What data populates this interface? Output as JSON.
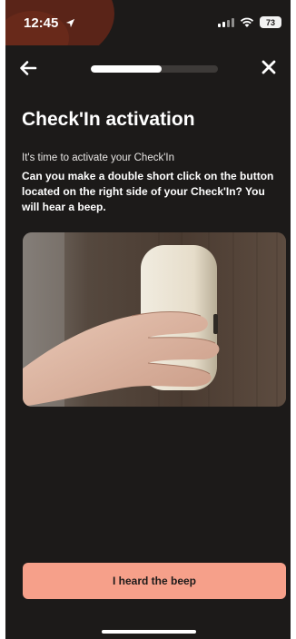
{
  "status_bar": {
    "time": "12:45",
    "battery": "73"
  },
  "onboarding": {
    "progress_percent": 56
  },
  "content": {
    "title": "Check'In activation",
    "subtitle": "It's time to activate your Check'In",
    "instruction": "Can you make a double short click on the button located on the right side of your Check'In? You will hear a beep."
  },
  "actions": {
    "confirm_label": "I heard the beep"
  },
  "colors": {
    "background": "#1c1a19",
    "accent": "#f6a08a",
    "progress_track": "#3d3a38",
    "progress_fill": "#ffffff"
  },
  "icons": {
    "back": "arrow-left-icon",
    "close": "close-icon",
    "location": "location-arrow-icon",
    "signal": "signal-icon",
    "wifi": "wifi-icon",
    "battery": "battery-icon"
  }
}
